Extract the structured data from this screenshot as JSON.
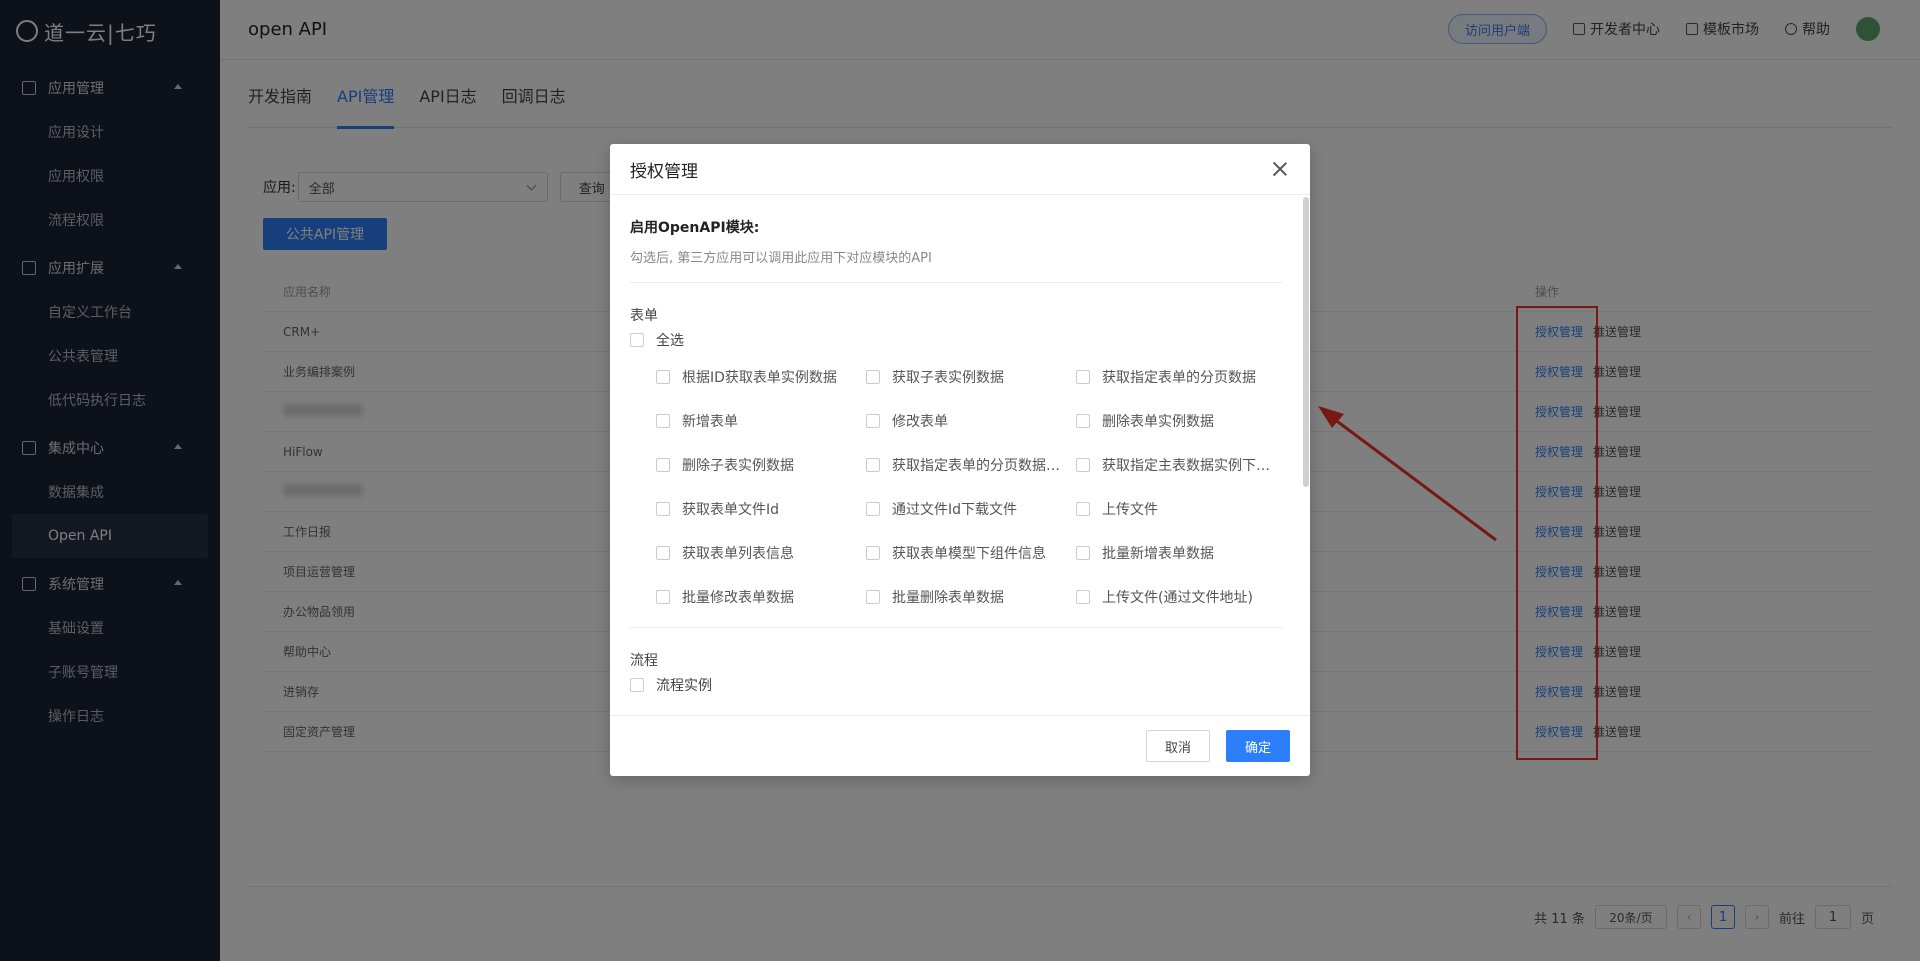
{
  "sidebar": {
    "logo_text": "道一云|七巧",
    "groups": [
      {
        "label": "应用管理",
        "items": [
          "应用设计",
          "应用权限",
          "流程权限"
        ]
      },
      {
        "label": "应用扩展",
        "items": [
          "自定义工作台",
          "公共表管理",
          "低代码执行日志"
        ]
      },
      {
        "label": "集成中心",
        "items": [
          "数据集成",
          "Open API"
        ]
      },
      {
        "label": "系统管理",
        "items": [
          "基础设置",
          "子账号管理",
          "操作日志"
        ]
      }
    ],
    "active_item": "Open API"
  },
  "header": {
    "title": "open API",
    "visit_btn": "访问用户端",
    "dev_center": "开发者中心",
    "template_market": "模板市场",
    "help": "帮助"
  },
  "tabs": [
    "开发指南",
    "API管理",
    "API日志",
    "回调日志"
  ],
  "active_tab": "API管理",
  "filter": {
    "label": "应用:",
    "value": "全部",
    "query_btn": "查询"
  },
  "public_api_btn": "公共API管理",
  "table": {
    "headers": {
      "name": "应用名称",
      "op": "操作"
    },
    "rows": [
      "CRM+",
      "业务编排案例",
      "",
      "HiFlow",
      "",
      "工作日报",
      "项目运营管理",
      "办公物品领用",
      "帮助中心",
      "进销存",
      "固定资产管理"
    ],
    "auth_label": "授权管理",
    "push_label": "推送管理"
  },
  "pagination": {
    "total": "共 11 条",
    "page_size": "20条/页",
    "current": "1",
    "goto_label": "前往",
    "goto_value": "1",
    "page_suffix": "页"
  },
  "modal": {
    "title": "授权管理",
    "enable_title": "启用OpenAPI模块:",
    "enable_desc": "勾选后, 第三方应用可以调用此应用下对应模块的API",
    "form_section": "表单",
    "select_all": "全选",
    "form_items": [
      "根据ID获取表单实例数据",
      "获取子表实例数据",
      "获取指定表单的分页数据",
      "新增表单",
      "修改表单",
      "删除表单实例数据",
      "删除子表实例数据",
      "获取指定表单的分页数据…",
      "获取指定主表数据实例下…",
      "获取表单文件Id",
      "通过文件Id下载文件",
      "上传文件",
      "获取表单列表信息",
      "获取表单模型下组件信息",
      "批量新增表单数据",
      "批量修改表单数据",
      "批量删除表单数据",
      "上传文件(通过文件地址)"
    ],
    "flow_section": "流程",
    "flow_items": [
      "流程实例"
    ],
    "cancel": "取消",
    "ok": "确定"
  },
  "colors": {
    "primary": "#2d7ff9",
    "sidebar_bg": "#1b2233",
    "annotation_red": "#f0302a"
  }
}
